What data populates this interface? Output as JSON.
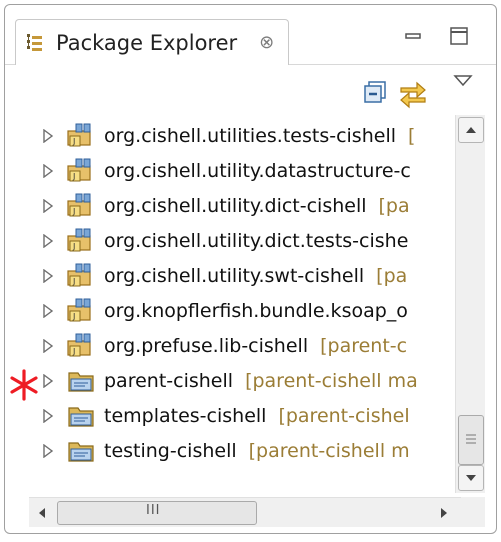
{
  "view": {
    "title": "Package Explorer",
    "close_glyph": "⊗"
  },
  "toolbar": {
    "collapse_all_icon": "collapse-all-icon",
    "link_with_editor_icon": "link-with-editor-icon",
    "view_menu_icon": "view-menu-icon"
  },
  "hscroll": {
    "thumb_glyph": "III"
  },
  "tree": {
    "rows": [
      {
        "name": "org.cishell.utilities.tests-cishell",
        "decoration": "["
      },
      {
        "name": "org.cishell.utility.datastructure-c",
        "decoration": ""
      },
      {
        "name": "org.cishell.utility.dict-cishell",
        "decoration": "[pa"
      },
      {
        "name": "org.cishell.utility.dict.tests-cishe",
        "decoration": ""
      },
      {
        "name": "org.cishell.utility.swt-cishell",
        "decoration": "[pa"
      },
      {
        "name": "org.knopflerfish.bundle.ksoap_o",
        "decoration": ""
      },
      {
        "name": "org.prefuse.lib-cishell",
        "decoration": "[parent-c"
      },
      {
        "name": "parent-cishell",
        "decoration": "[parent-cishell ma"
      },
      {
        "name": "templates-cishell",
        "decoration": "[parent-cishel"
      },
      {
        "name": "testing-cishell",
        "decoration": "[parent-cishell m"
      }
    ]
  },
  "colors": {
    "decoration_text": "#9b7d36",
    "marker": "#ee1c24"
  }
}
